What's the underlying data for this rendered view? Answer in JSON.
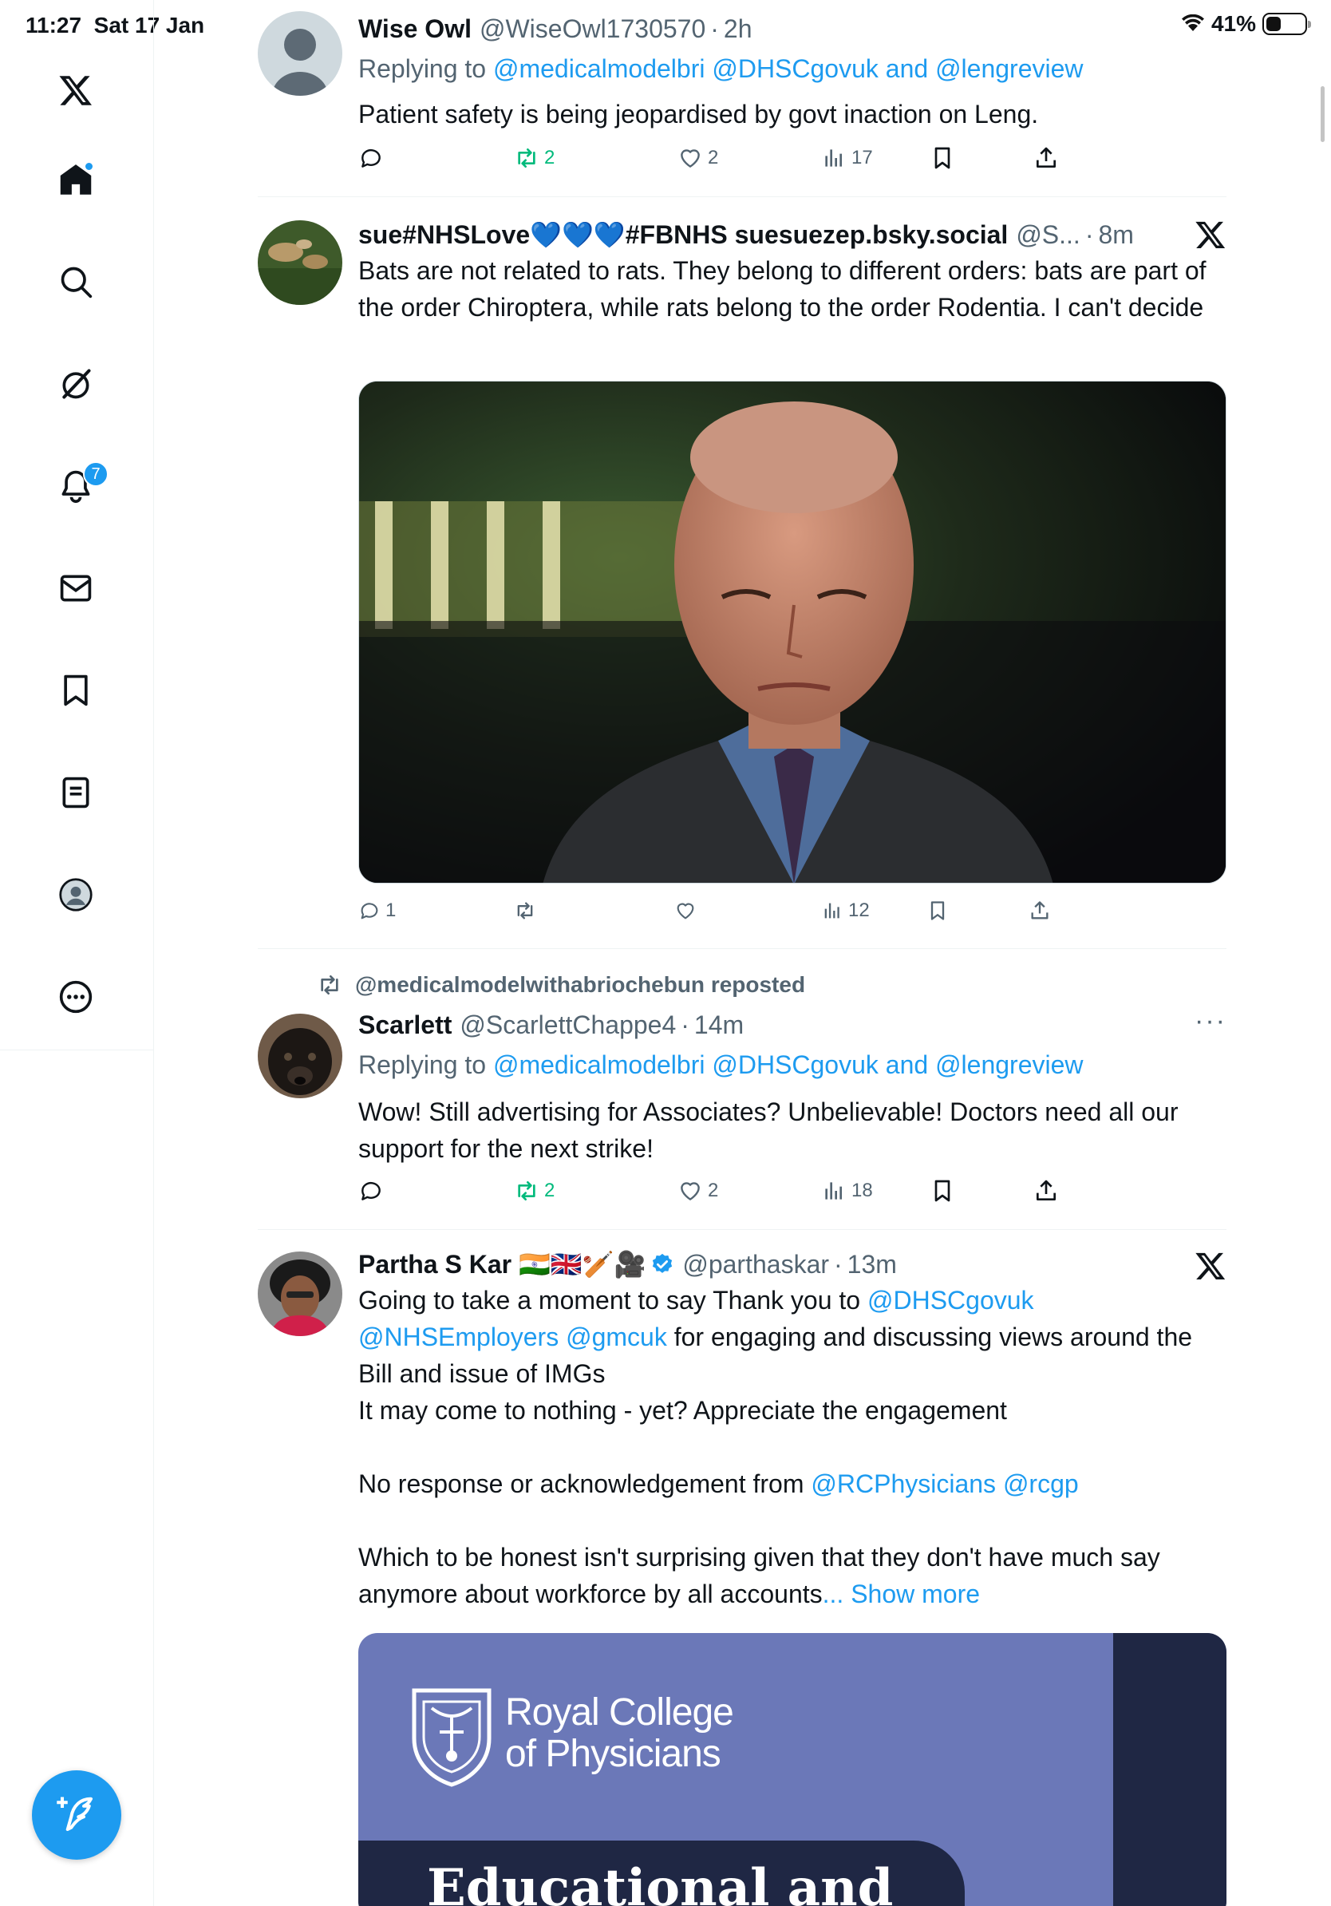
{
  "status_bar": {
    "time": "11:27",
    "date": "Sat 17 Jan",
    "battery": "41%",
    "battery_level": 0.41
  },
  "sidebar": {
    "items": [
      {
        "name": "x-logo-icon"
      },
      {
        "name": "home-icon"
      },
      {
        "name": "search-icon"
      },
      {
        "name": "grok-icon"
      },
      {
        "name": "notifications-icon",
        "badge": "7"
      },
      {
        "name": "messages-icon"
      },
      {
        "name": "bookmarks-icon"
      },
      {
        "name": "lists-icon"
      },
      {
        "name": "profile-icon"
      },
      {
        "name": "more-icon"
      }
    ],
    "compose": "compose-icon"
  },
  "tweets": [
    {
      "name": "Wise Owl",
      "handle": "@WiseOwl1730570",
      "sep": "·",
      "time": "2h",
      "reply_prefix": "Replying to ",
      "reply_links": "@medicalmodelbri @DHSCgovuk and @lengreview",
      "text": "Patient safety is being jeopardised by govt inaction on Leng.",
      "stats": {
        "replies": "",
        "reposts": "2",
        "likes": "2",
        "views": "17"
      }
    },
    {
      "name": "sue#NHSLove💙💙💙#FBNHS suesuezep.bsky.social",
      "handle": "@S...",
      "sep": "·",
      "time": "8m",
      "text": "Bats are not related to rats. They belong to different orders: bats are part of the order Chiroptera, while rats belong to the order Rodentia. I can't decide",
      "stats": {
        "replies": "1",
        "reposts": "",
        "likes": "",
        "views": "12"
      }
    },
    {
      "repost_label": "@medicalmodelwithabriochebun reposted",
      "name": "Scarlett",
      "handle": "@ScarlettChappe4",
      "sep": "·",
      "time": "14m",
      "more": "···",
      "reply_prefix": "Replying to ",
      "reply_links": "@medicalmodelbri @DHSCgovuk and @lengreview",
      "text": "Wow! Still advertising for Associates? Unbelievable! Doctors need all our support for the next strike!",
      "stats": {
        "replies": "",
        "reposts": "2",
        "likes": "2",
        "views": "18"
      }
    },
    {
      "name": "Partha S Kar 🇮🇳🇬🇧🏏🎥",
      "handle": "@parthaskar",
      "sep": "·",
      "time": "13m",
      "text_1_prefix": "Going to take a moment to say Thank you to ",
      "text_1_link1": "@DHSCgovuk",
      "text_1_link2": "@NHSEmployers @gmcuk",
      "text_1_suffix": " for engaging and discussing views around the Bill and issue of IMGs",
      "text_2": "It may come to nothing - yet? Appreciate the engagement",
      "text_3_prefix": "No response or acknowledgement from ",
      "text_3_links": "@RCPhysicians @rcgp",
      "text_4": "Which to be honest isn't surprising given that they don't have much say anymore about workforce by all accounts",
      "show_more": "... Show more",
      "card": {
        "logo_line1": "Royal College",
        "logo_line2": "of Physicians",
        "headline": "Educational and"
      }
    }
  ],
  "colors": {
    "accent": "#1d9bf0",
    "repost_green": "#00ba7c",
    "muted": "#536471",
    "card_purple": "#6b78b8",
    "card_navy": "#1f2744"
  }
}
